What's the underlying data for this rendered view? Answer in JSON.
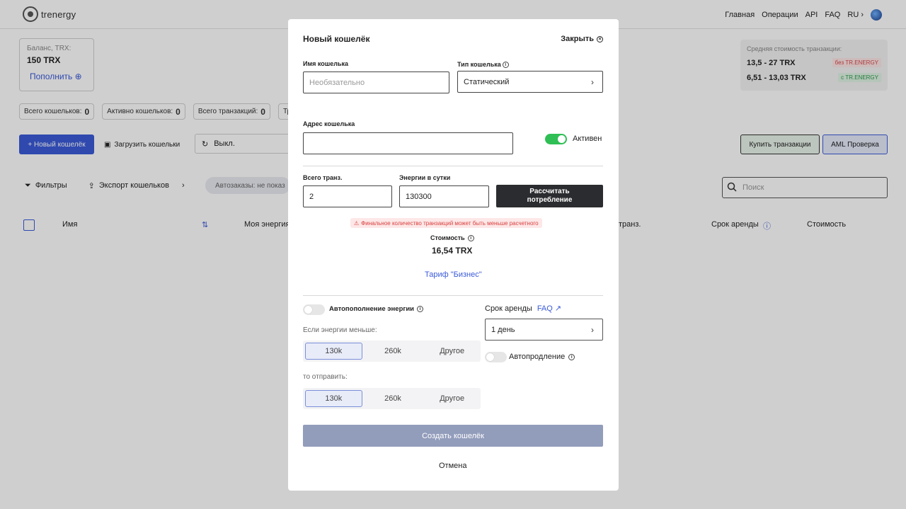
{
  "header": {
    "logo_text": "trenergy",
    "nav": [
      "Главная",
      "Операции",
      "API",
      "FAQ"
    ],
    "lang": "RU"
  },
  "balance": {
    "label": "Баланс, TRX:",
    "value": "150 TRX",
    "topup": "Пополнить"
  },
  "stats": [
    {
      "label": "Всего кошельков:",
      "value": "0"
    },
    {
      "label": "Активно кошельков:",
      "value": "0"
    },
    {
      "label": "Всего транзакций:",
      "value": "0"
    },
    {
      "label": "Тр",
      "value": ""
    }
  ],
  "toolbar": {
    "new_wallet": "+ Новый кошелёк",
    "upload": "Загрузить кошельки",
    "refresh_value": "Выкл.",
    "buy": "Купить транзакции",
    "aml": "AML Проверка"
  },
  "avg_cost": {
    "title": "Средняя стоимость транзакции:",
    "rows": [
      {
        "value": "13,5 - 27 TRX",
        "tag": "без TR.ENERGY"
      },
      {
        "value": "6,51 - 13,03 TRX",
        "tag": "с TR.ENERGY"
      }
    ]
  },
  "filters": {
    "filters_label": "Фильтры",
    "export_label": "Экспорт кошельков",
    "autoorders": "Автозаказы: не показ",
    "search_placeholder": "Поиск"
  },
  "table": {
    "columns": [
      "Имя",
      "Моя энергия",
      "транз.",
      "Срок аренды",
      "Стоимость"
    ]
  },
  "modal": {
    "title": "Новый кошелёк",
    "close": "Закрыть",
    "wallet_name_label": "Имя кошелька",
    "wallet_name_placeholder": "Необязательно",
    "wallet_type_label": "Тип кошелька",
    "wallet_type_value": "Статический",
    "address_label": "Адрес кошелька",
    "address_value": "",
    "active_label": "Активен",
    "tx_total_label": "Всего транз.",
    "tx_total_value": "2",
    "energy_label": "Энергии в сутки",
    "energy_value": "130300",
    "calc_button": "Рассчитать потребление",
    "warning": "Финальное количество транзакций может быть меньше расчетного",
    "cost_label": "Стоимость",
    "cost_value": "16,54 TRX",
    "tariff_link": "Тариф \"Бизнес\"",
    "auto_refill_label": "Автопополнение энергии",
    "if_less_label": "Если энергии меньше:",
    "threshold_options": [
      "130k",
      "260k",
      "Другое"
    ],
    "send_label": "то отправить:",
    "send_options": [
      "130k",
      "260k",
      "Другое"
    ],
    "rent_term_label": "Срок аренды",
    "rent_faq": "FAQ",
    "rent_term_value": "1 день",
    "auto_renew_label": "Автопродление",
    "create_button": "Создать кошелёк",
    "cancel_button": "Отмена"
  },
  "colors": {
    "accent": "#3a5ad8",
    "toggle_on": "#2fbf54",
    "create_disabled": "#929cbb",
    "dark_button": "#2b2c2f"
  }
}
